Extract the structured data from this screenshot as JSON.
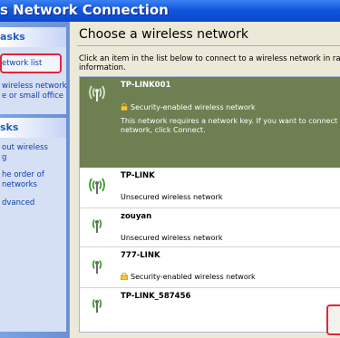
{
  "window": {
    "title": "s Network Connection"
  },
  "left_panel": {
    "network_tasks": {
      "header": "asks",
      "items": [
        {
          "label": "etwork list"
        }
      ]
    },
    "extra_tasks": {
      "items": [
        {
          "label": "wireless network"
        },
        {
          "label": "e or small office"
        }
      ]
    },
    "related_tasks": {
      "header": "sks",
      "items": [
        {
          "line1": "out wireless",
          "line2": "g"
        },
        {
          "line1": "he order of",
          "line2": "networks"
        },
        {
          "line1": "dvanced",
          "line2": ""
        }
      ]
    }
  },
  "main": {
    "title": "Choose a wireless network",
    "description_line1": "Click an item in the list below to connect to a wireless network in range or to ge",
    "description_line2": "information."
  },
  "networks": [
    {
      "name": "TP-LINK001",
      "security": "Security-enabled wireless network",
      "secured": true,
      "selected": true,
      "note_line1": "This network requires a network key. If you want to connect to th",
      "note_line2": "network, click Connect."
    },
    {
      "name": "TP-LINK",
      "security": "Unsecured wireless network",
      "secured": false
    },
    {
      "name": "zouyan",
      "security": "Unsecured wireless network",
      "secured": false
    },
    {
      "name": "777-LINK",
      "security": "Security-enabled wireless network",
      "secured": true
    },
    {
      "name": "TP-LINK_587456",
      "security": "",
      "secured": false
    }
  ],
  "colors": {
    "selection": "#6e7f52",
    "highlight_box": "#e2243a",
    "signal_green": "#3aa12c"
  },
  "icons": {
    "signal": "wireless-signal-icon",
    "lock": "lock-icon"
  }
}
